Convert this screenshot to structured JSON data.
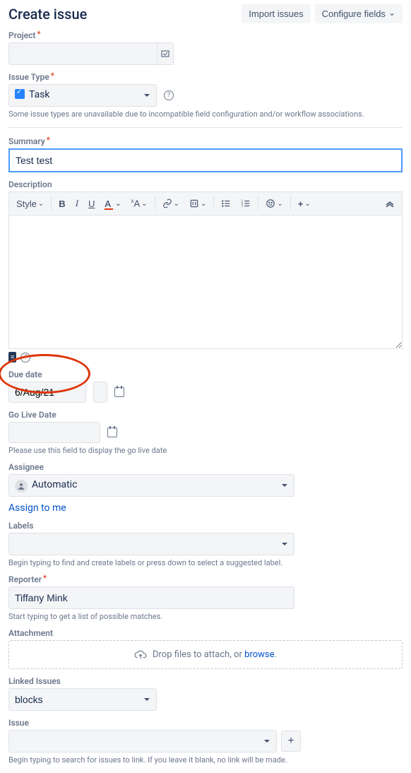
{
  "header": {
    "title": "Create issue",
    "import_btn": "Import issues",
    "configure_btn": "Configure fields"
  },
  "project": {
    "label": "Project",
    "value": ""
  },
  "issuetype": {
    "label": "Issue Type",
    "value": "Task",
    "helper": "Some issue types are unavailable due to incompatible field configuration and/or workflow associations."
  },
  "summary": {
    "label": "Summary",
    "value": "Test test"
  },
  "description": {
    "label": "Description",
    "style_btn": "Style"
  },
  "duedate": {
    "label": "Due date",
    "value": "6/Aug/21"
  },
  "golive": {
    "label": "Go Live Date",
    "value": "",
    "helper": "Please use this field to display the go live date"
  },
  "assignee": {
    "label": "Assignee",
    "value": "Automatic",
    "assign_me": "Assign to me"
  },
  "labels": {
    "label": "Labels",
    "helper": "Begin typing to find and create labels or press down to select a suggested label."
  },
  "reporter": {
    "label": "Reporter",
    "value": "Tiffany Mink",
    "helper": "Start typing to get a list of possible matches."
  },
  "attachment": {
    "label": "Attachment",
    "drop_text": "Drop files to attach, or ",
    "browse": "browse",
    "dot": "."
  },
  "linked": {
    "label": "Linked Issues",
    "value": "blocks"
  },
  "issue": {
    "label": "Issue",
    "helper": "Begin typing to search for issues to link. If you leave it blank, no link will be made."
  }
}
